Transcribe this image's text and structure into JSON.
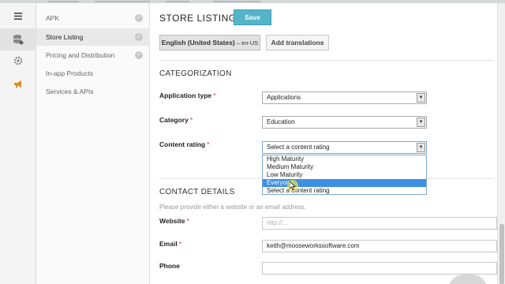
{
  "colors": {
    "accent": "#56b4c8",
    "selected_option": "#3c8fe3",
    "required_marker": "#cc3333",
    "cursor_highlight": "#f0e63c"
  },
  "rail": {
    "icons": [
      "menu-icon",
      "database-icon",
      "gear-icon",
      "megaphone-icon"
    ]
  },
  "sidebar": {
    "items": [
      {
        "label": "APK",
        "done": true
      },
      {
        "label": "Store Listing",
        "done": true,
        "active": true
      },
      {
        "label": "Pricing and Distribution",
        "done": true
      },
      {
        "label": "In-app Products"
      },
      {
        "label": "Services & APIs"
      }
    ]
  },
  "header": {
    "title": "STORE LISTING",
    "save_label": "Save"
  },
  "language": {
    "current_label": "English (United States)",
    "current_code": "– en-US",
    "add_translations_label": "Add translations"
  },
  "categorization": {
    "heading": "CATEGORIZATION",
    "required_marker": "*",
    "application_type": {
      "label": "Application type",
      "value": "Applications"
    },
    "category": {
      "label": "Category",
      "value": "Education"
    },
    "content_rating": {
      "label": "Content rating",
      "value": "Select a content rating",
      "options": [
        "High Maturity",
        "Medium Maturity",
        "Low Maturity",
        "Everyone",
        "Select a content rating"
      ],
      "highlighted": "Everyone"
    }
  },
  "contact": {
    "heading": "CONTACT DETAILS",
    "helper": "Please provide either a website or an email address.",
    "website": {
      "label": "Website",
      "value": "",
      "placeholder": "http://..."
    },
    "email": {
      "label": "Email",
      "value": "keith@mooseworkssoftware.com"
    },
    "phone": {
      "label": "Phone",
      "value": ""
    }
  }
}
